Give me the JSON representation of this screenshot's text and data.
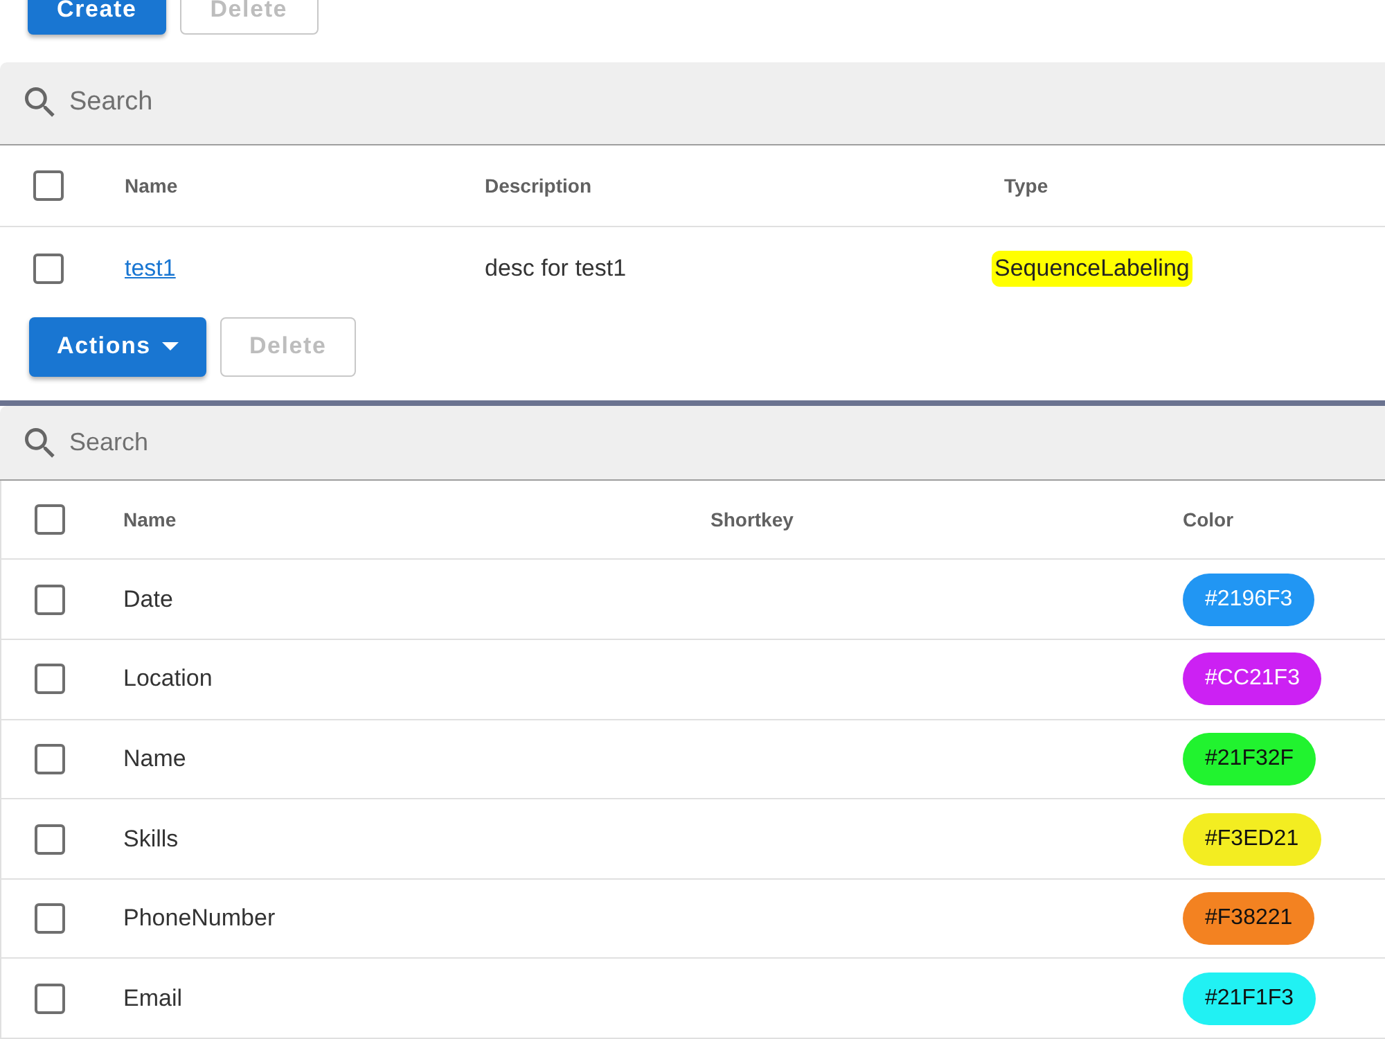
{
  "projects": {
    "buttons": [
      {
        "label": "Create",
        "kind": "contained",
        "disabled": false
      },
      {
        "label": "Delete",
        "kind": "outlined",
        "disabled": true
      }
    ],
    "search": {
      "placeholder": "Search"
    },
    "table": {
      "all_checked": false,
      "columns": [
        "Name",
        "Description",
        "Type"
      ],
      "rows": [
        {
          "checked": false,
          "name": "test1",
          "description": "desc for test1",
          "type": "SequenceLabeling",
          "highlighted": true
        }
      ]
    }
  },
  "labels": {
    "buttons": [
      {
        "label": "Actions",
        "kind": "dropdown",
        "disabled": false
      },
      {
        "label": "Delete",
        "kind": "outlined",
        "disabled": true
      }
    ],
    "search": {
      "placeholder": "Search"
    },
    "table": {
      "all_checked": false,
      "columns": [
        "Name",
        "Shortkey",
        "Color"
      ],
      "rows": [
        {
          "checked": false,
          "name": "Date",
          "color": "#2196f3",
          "color_label": "#2196F3"
        },
        {
          "checked": false,
          "name": "Location",
          "color": "#cc21f3",
          "color_label": "#CC21F3"
        },
        {
          "checked": false,
          "name": "Name",
          "color": "#21f32f",
          "color_label": "#21F32F"
        },
        {
          "checked": false,
          "name": "Skills",
          "color": "#f3ed21",
          "color_label": "#F3ED21"
        },
        {
          "checked": false,
          "name": "PhoneNumber",
          "color": "#f38221",
          "color_label": "#F38221"
        },
        {
          "checked": false,
          "name": "Email",
          "color": "#21f1f3",
          "color_label": "#21F1F3"
        }
      ]
    }
  }
}
